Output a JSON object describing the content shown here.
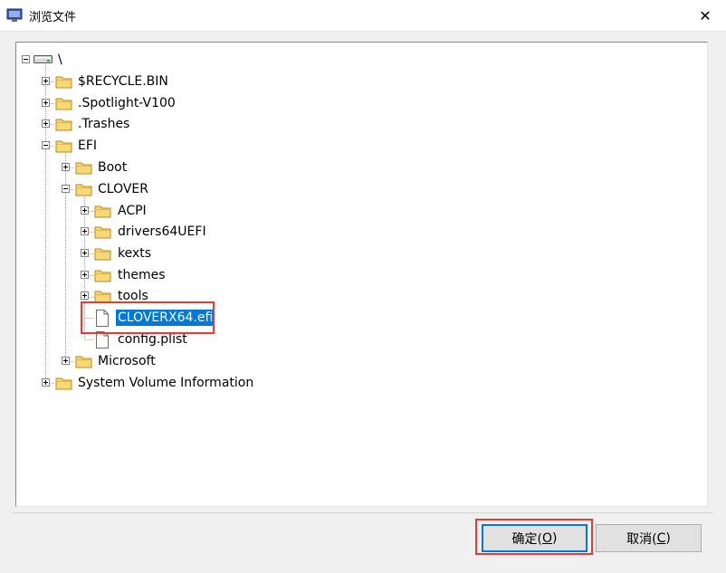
{
  "window": {
    "title": "浏览文件",
    "close_symbol": "✕"
  },
  "tree": {
    "root_label": "\\",
    "items": [
      {
        "label": "$RECYCLE.BIN",
        "kind": "folder",
        "expander": "plus"
      },
      {
        "label": ".Spotlight-V100",
        "kind": "folder",
        "expander": "plus"
      },
      {
        "label": ".Trashes",
        "kind": "folder",
        "expander": "plus"
      },
      {
        "label": "EFI",
        "kind": "folder",
        "expander": "minus"
      },
      {
        "label": "Boot",
        "kind": "folder",
        "expander": "plus"
      },
      {
        "label": "CLOVER",
        "kind": "folder",
        "expander": "minus"
      },
      {
        "label": "ACPI",
        "kind": "folder",
        "expander": "plus"
      },
      {
        "label": "drivers64UEFI",
        "kind": "folder",
        "expander": "plus"
      },
      {
        "label": "kexts",
        "kind": "folder",
        "expander": "plus"
      },
      {
        "label": "themes",
        "kind": "folder",
        "expander": "plus"
      },
      {
        "label": "tools",
        "kind": "folder",
        "expander": "plus"
      },
      {
        "label": "CLOVERX64.efi",
        "kind": "file",
        "selected": true
      },
      {
        "label": "config.plist",
        "kind": "file"
      },
      {
        "label": "Microsoft",
        "kind": "folder",
        "expander": "plus"
      },
      {
        "label": "System Volume Information",
        "kind": "folder",
        "expander": "plus"
      }
    ]
  },
  "buttons": {
    "ok": {
      "label": "确定(",
      "mnemonic": "O",
      "suffix": ")"
    },
    "cancel": {
      "label": "取消(",
      "mnemonic": "C",
      "suffix": ")"
    }
  },
  "colors": {
    "selection": "#0078d7",
    "annotation_box": "#e53a3a",
    "folder": "#f8d775"
  }
}
